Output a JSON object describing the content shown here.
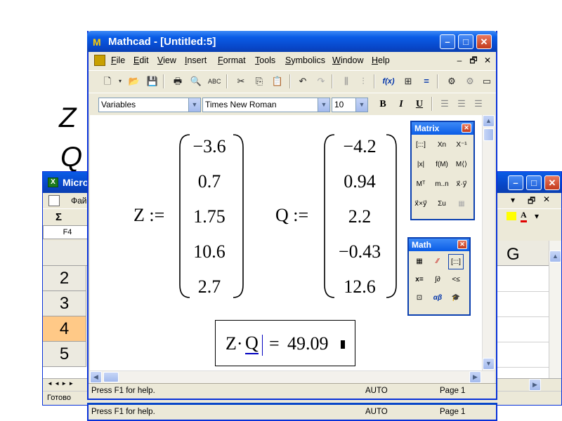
{
  "slide": {
    "letter_z": "Z",
    "letter_q": "Q"
  },
  "excel": {
    "title": "Micro",
    "menu_partial": "Фай",
    "sigma": "Σ",
    "namebox": "F4",
    "column_g": "G",
    "rows": [
      "2",
      "3",
      "4",
      "5"
    ],
    "selected_row": "4",
    "status": "Готово",
    "nav": "◄ ◄ ► ►"
  },
  "mathcad": {
    "title": "Mathcad - [Untitled:5]",
    "menu": [
      "File",
      "Edit",
      "View",
      "Insert",
      "Format",
      "Tools",
      "Symbolics",
      "Window",
      "Help"
    ],
    "style_combo": "Variables",
    "font_combo": "Times New Roman",
    "size_combo": "10",
    "bold": "B",
    "italic": "I",
    "underline": "U",
    "z_label": "Z :=",
    "z_values": [
      "−3.6",
      "0.7",
      "1.75",
      "10.6",
      "2.7"
    ],
    "q_label": "Q :=",
    "q_values": [
      "−4.2",
      "0.94",
      "2.2",
      "−0.43",
      "12.6"
    ],
    "expr_z": "Z·",
    "expr_q": "Q",
    "expr_eq": "=",
    "expr_result": "49.09",
    "status_help": "Press F1 for help.",
    "status_mode": "AUTO",
    "status_page": "Page 1"
  },
  "palettes": {
    "matrix_title": "Matrix",
    "math_title": "Math",
    "matrix_cells": [
      "[:::]",
      "Xn",
      "X⁻¹",
      "|x|",
      "f(M)",
      "M⟨⟩",
      "Mᵀ",
      "m..n",
      "x⃗·y⃗",
      "x⃗×y⃗",
      "Σu",
      "▦"
    ],
    "math_cells": [
      "▦",
      "⁄⁄",
      "[:::]",
      "x=",
      "∫∂",
      "<≤",
      "⊡",
      "αβ",
      "🎓"
    ]
  },
  "colors": {
    "titlebar": "#0a5ce6",
    "selected_row": "#ffc987",
    "face": "#ece9d8"
  }
}
